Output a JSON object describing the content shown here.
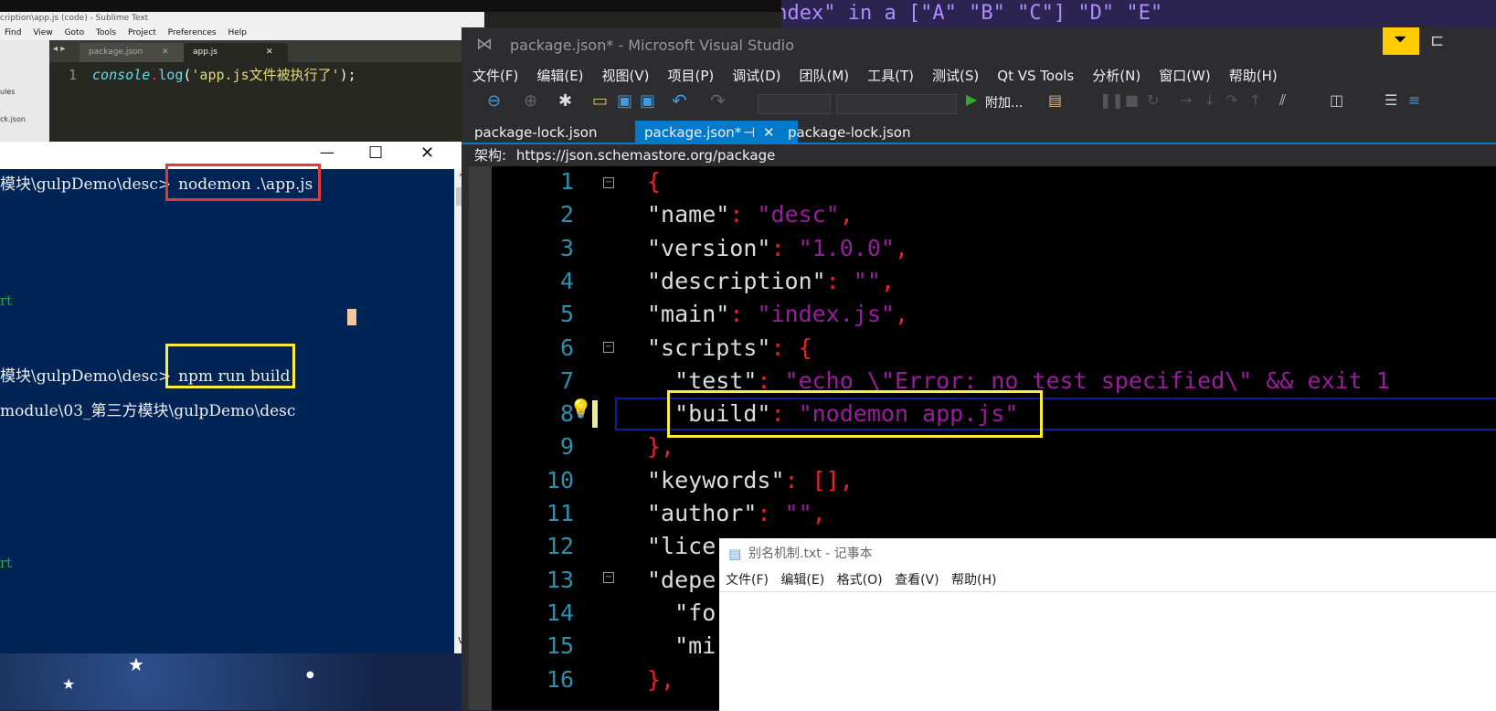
{
  "desktop": {
    "top_strip_text": "\"ndex\" in a [\"A\" \"B\" \"C\"] \"D\" \"E\""
  },
  "sublime": {
    "title": "cription\\app.js (code) - Sublime Text",
    "menu": [
      "Find",
      "View",
      "Goto",
      "Tools",
      "Project",
      "Preferences",
      "Help"
    ],
    "sidebar": [
      "ules",
      "ck.json"
    ],
    "tabs": [
      "package.json",
      "app.js"
    ],
    "line_no": "1",
    "code": {
      "fn_obj": "console",
      "dot": ".",
      "fn": "log",
      "open": "(",
      "str": "'app.js文件被执行了'",
      "close": ");"
    }
  },
  "cmd": {
    "controls": {
      "minimize": "—",
      "maximize": "☐",
      "close": "✕"
    },
    "lines": [
      {
        "prompt": "模块\\gulpDemo\\desc>",
        "command": "nodemon .\\app.js"
      },
      {
        "text": "rt"
      },
      {
        "prompt": "模块\\gulpDemo\\desc>",
        "command": "npm run build"
      },
      {
        "text": "module\\03_第三方模块\\gulpDemo\\desc"
      },
      {
        "text": "rt"
      }
    ],
    "scroll_up": "^",
    "scroll_down": "v"
  },
  "vs": {
    "title": "package.json* - Microsoft Visual Studio",
    "menu": [
      "文件(F)",
      "编辑(E)",
      "视图(V)",
      "项目(P)",
      "调试(D)",
      "团队(M)",
      "工具(T)",
      "测试(S)",
      "Qt VS Tools",
      "分析(N)",
      "窗口(W)",
      "帮助(H)"
    ],
    "toolbar": {
      "attach_label": "附加..."
    },
    "tabs": [
      {
        "label": "package-lock.json",
        "active": false
      },
      {
        "label": "package.json*",
        "active": true,
        "pin": "⊣",
        "close": "✕"
      },
      {
        "label": "package-lock.json",
        "active": false
      }
    ],
    "schema_label": "架构:",
    "schema_url": "https://json.schemastore.org/package",
    "lines": [
      {
        "n": "1",
        "parts": [
          [
            "p",
            "{"
          ]
        ]
      },
      {
        "n": "2",
        "parts": [
          [
            "k",
            "\"name\""
          ],
          [
            "p",
            ": "
          ],
          [
            "s",
            "\"desc\""
          ],
          [
            "p",
            ","
          ]
        ]
      },
      {
        "n": "3",
        "parts": [
          [
            "k",
            "\"version\""
          ],
          [
            "p",
            ": "
          ],
          [
            "s",
            "\"1.0.0\""
          ],
          [
            "p",
            ","
          ]
        ]
      },
      {
        "n": "4",
        "parts": [
          [
            "k",
            "\"description\""
          ],
          [
            "p",
            ": "
          ],
          [
            "s",
            "\"\""
          ],
          [
            "p",
            ","
          ]
        ]
      },
      {
        "n": "5",
        "parts": [
          [
            "k",
            "\"main\""
          ],
          [
            "p",
            ": "
          ],
          [
            "s",
            "\"index.js\""
          ],
          [
            "p",
            ","
          ]
        ]
      },
      {
        "n": "6",
        "parts": [
          [
            "k",
            "\"scripts\""
          ],
          [
            "p",
            ": {"
          ]
        ]
      },
      {
        "n": "7",
        "parts": [
          [
            "k",
            "  \"test\""
          ],
          [
            "p",
            ": "
          ],
          [
            "s",
            "\"echo \\\"Error: no test specified\\\" && exit 1"
          ]
        ]
      },
      {
        "n": "8",
        "parts": [
          [
            "k",
            "  \"build\""
          ],
          [
            "p",
            ": "
          ],
          [
            "s",
            "\"nodemon app.js\""
          ]
        ]
      },
      {
        "n": "9",
        "parts": [
          [
            "p",
            "},"
          ]
        ]
      },
      {
        "n": "10",
        "parts": [
          [
            "k",
            "\"keywords\""
          ],
          [
            "p",
            ": [],"
          ]
        ]
      },
      {
        "n": "11",
        "parts": [
          [
            "k",
            "\"author\""
          ],
          [
            "p",
            ": "
          ],
          [
            "s",
            "\"\""
          ],
          [
            "p",
            ","
          ]
        ]
      },
      {
        "n": "12",
        "parts": [
          [
            "k",
            "\"lice"
          ]
        ]
      },
      {
        "n": "13",
        "parts": [
          [
            "k",
            "\"depe"
          ]
        ]
      },
      {
        "n": "14",
        "parts": [
          [
            "k",
            "  \"fo"
          ]
        ]
      },
      {
        "n": "15",
        "parts": [
          [
            "k",
            "  \"mi"
          ]
        ]
      },
      {
        "n": "16",
        "parts": [
          [
            "p",
            "},"
          ]
        ]
      }
    ]
  },
  "notepad": {
    "title": "别名机制.txt - 记事本",
    "menu": [
      "文件(F)",
      "编辑(E)",
      "格式(O)",
      "查看(V)",
      "帮助(H)"
    ]
  },
  "colors": {
    "vs_accent": "#007acc",
    "highlight_yellow": "#ffeb3b",
    "highlight_red": "#e53935",
    "cmd_bg": "#012456"
  }
}
